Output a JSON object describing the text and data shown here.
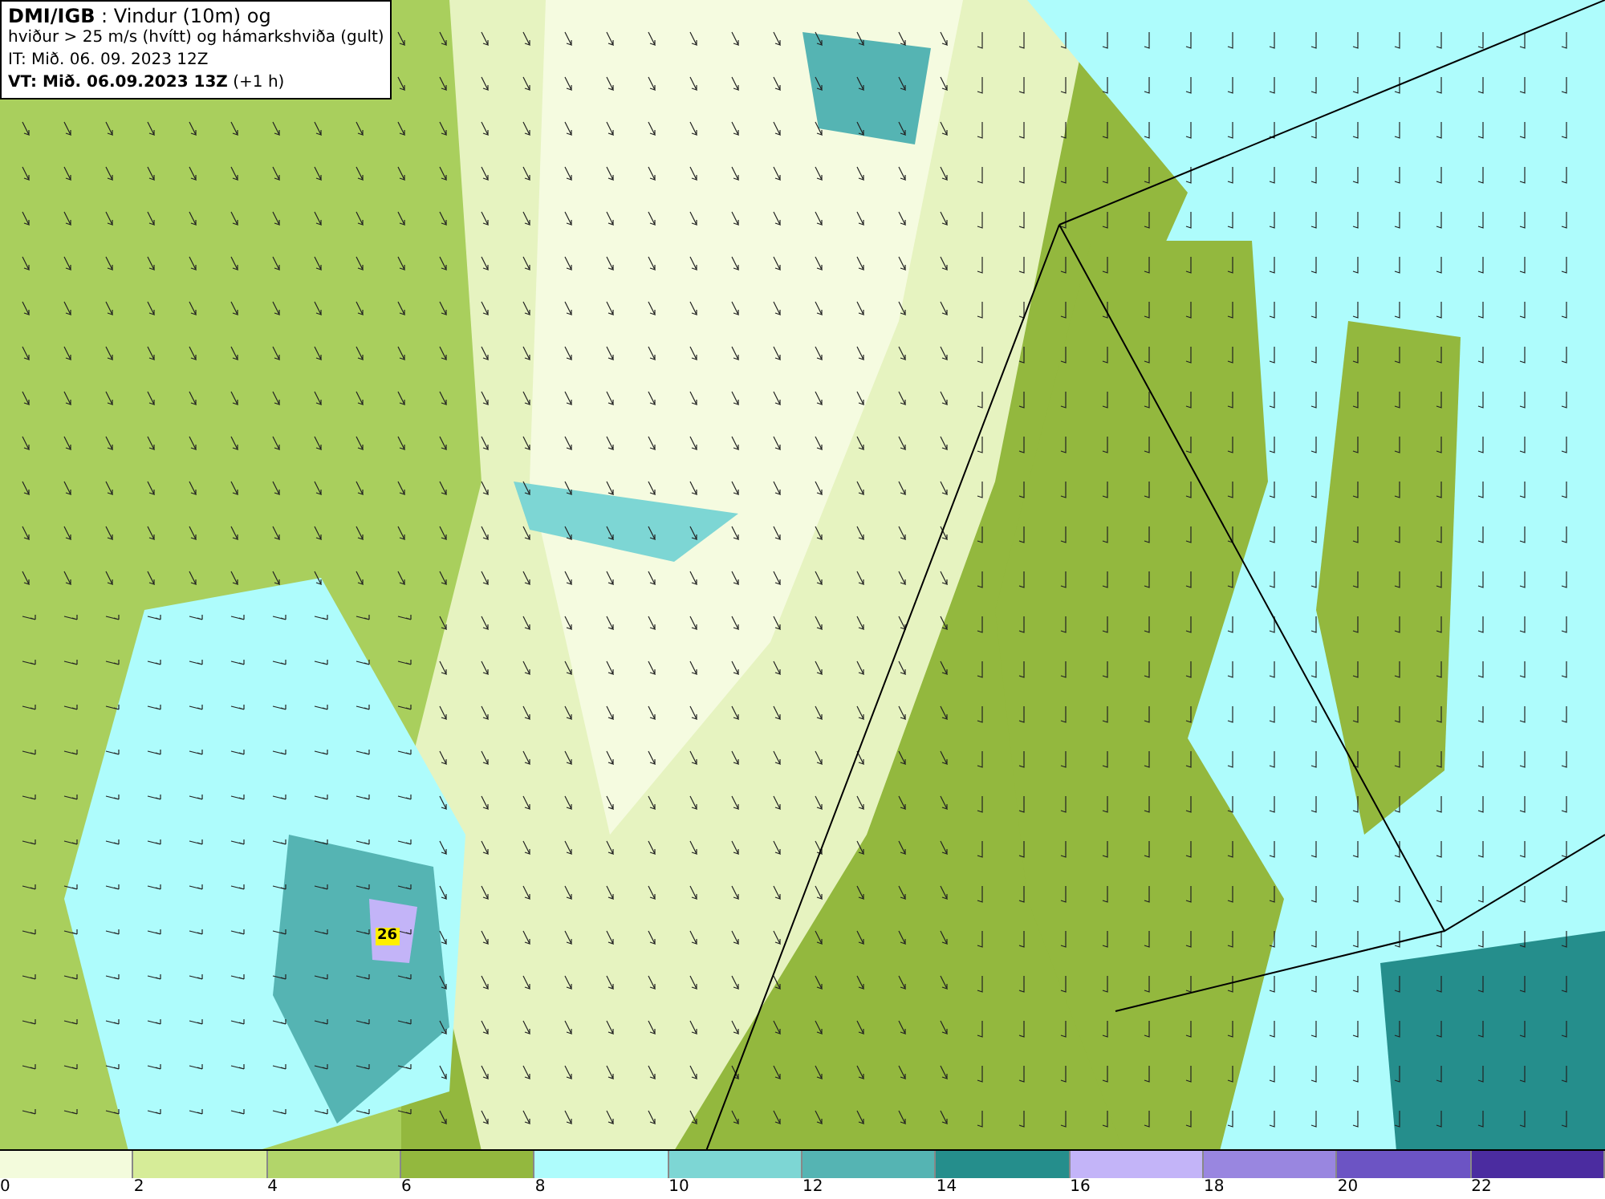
{
  "info_box": {
    "lines": [
      "**DMI/IGB** : Vindur (10m) og",
      "hviður > 25 m/s (hvítt) og hámarkshviða (gult)",
      "IT: Mið. 06. 09. 2023 12Z",
      "**VT: Mið. 06.09.2023 13Z** (+1 h)"
    ]
  },
  "map": {
    "gust_label": "26"
  },
  "legend": [
    {
      "label": "0",
      "color": "#f3fbdc"
    },
    {
      "label": "2",
      "color": "#d6ec98"
    },
    {
      "label": "4",
      "color": "#b2d56a"
    },
    {
      "label": "6",
      "color": "#93b83e"
    },
    {
      "label": "8",
      "color": "#aefcfc"
    },
    {
      "label": "10",
      "color": "#7dd6d4"
    },
    {
      "label": "12",
      "color": "#55b4b3"
    },
    {
      "label": "14",
      "color": "#258e8c"
    },
    {
      "label": "16",
      "color": "#c3b4f8"
    },
    {
      "label": "18",
      "color": "#9986e0"
    },
    {
      "label": "20",
      "color": "#6c54c4"
    },
    {
      "label": "22",
      "color": "#4b2ca0"
    }
  ]
}
